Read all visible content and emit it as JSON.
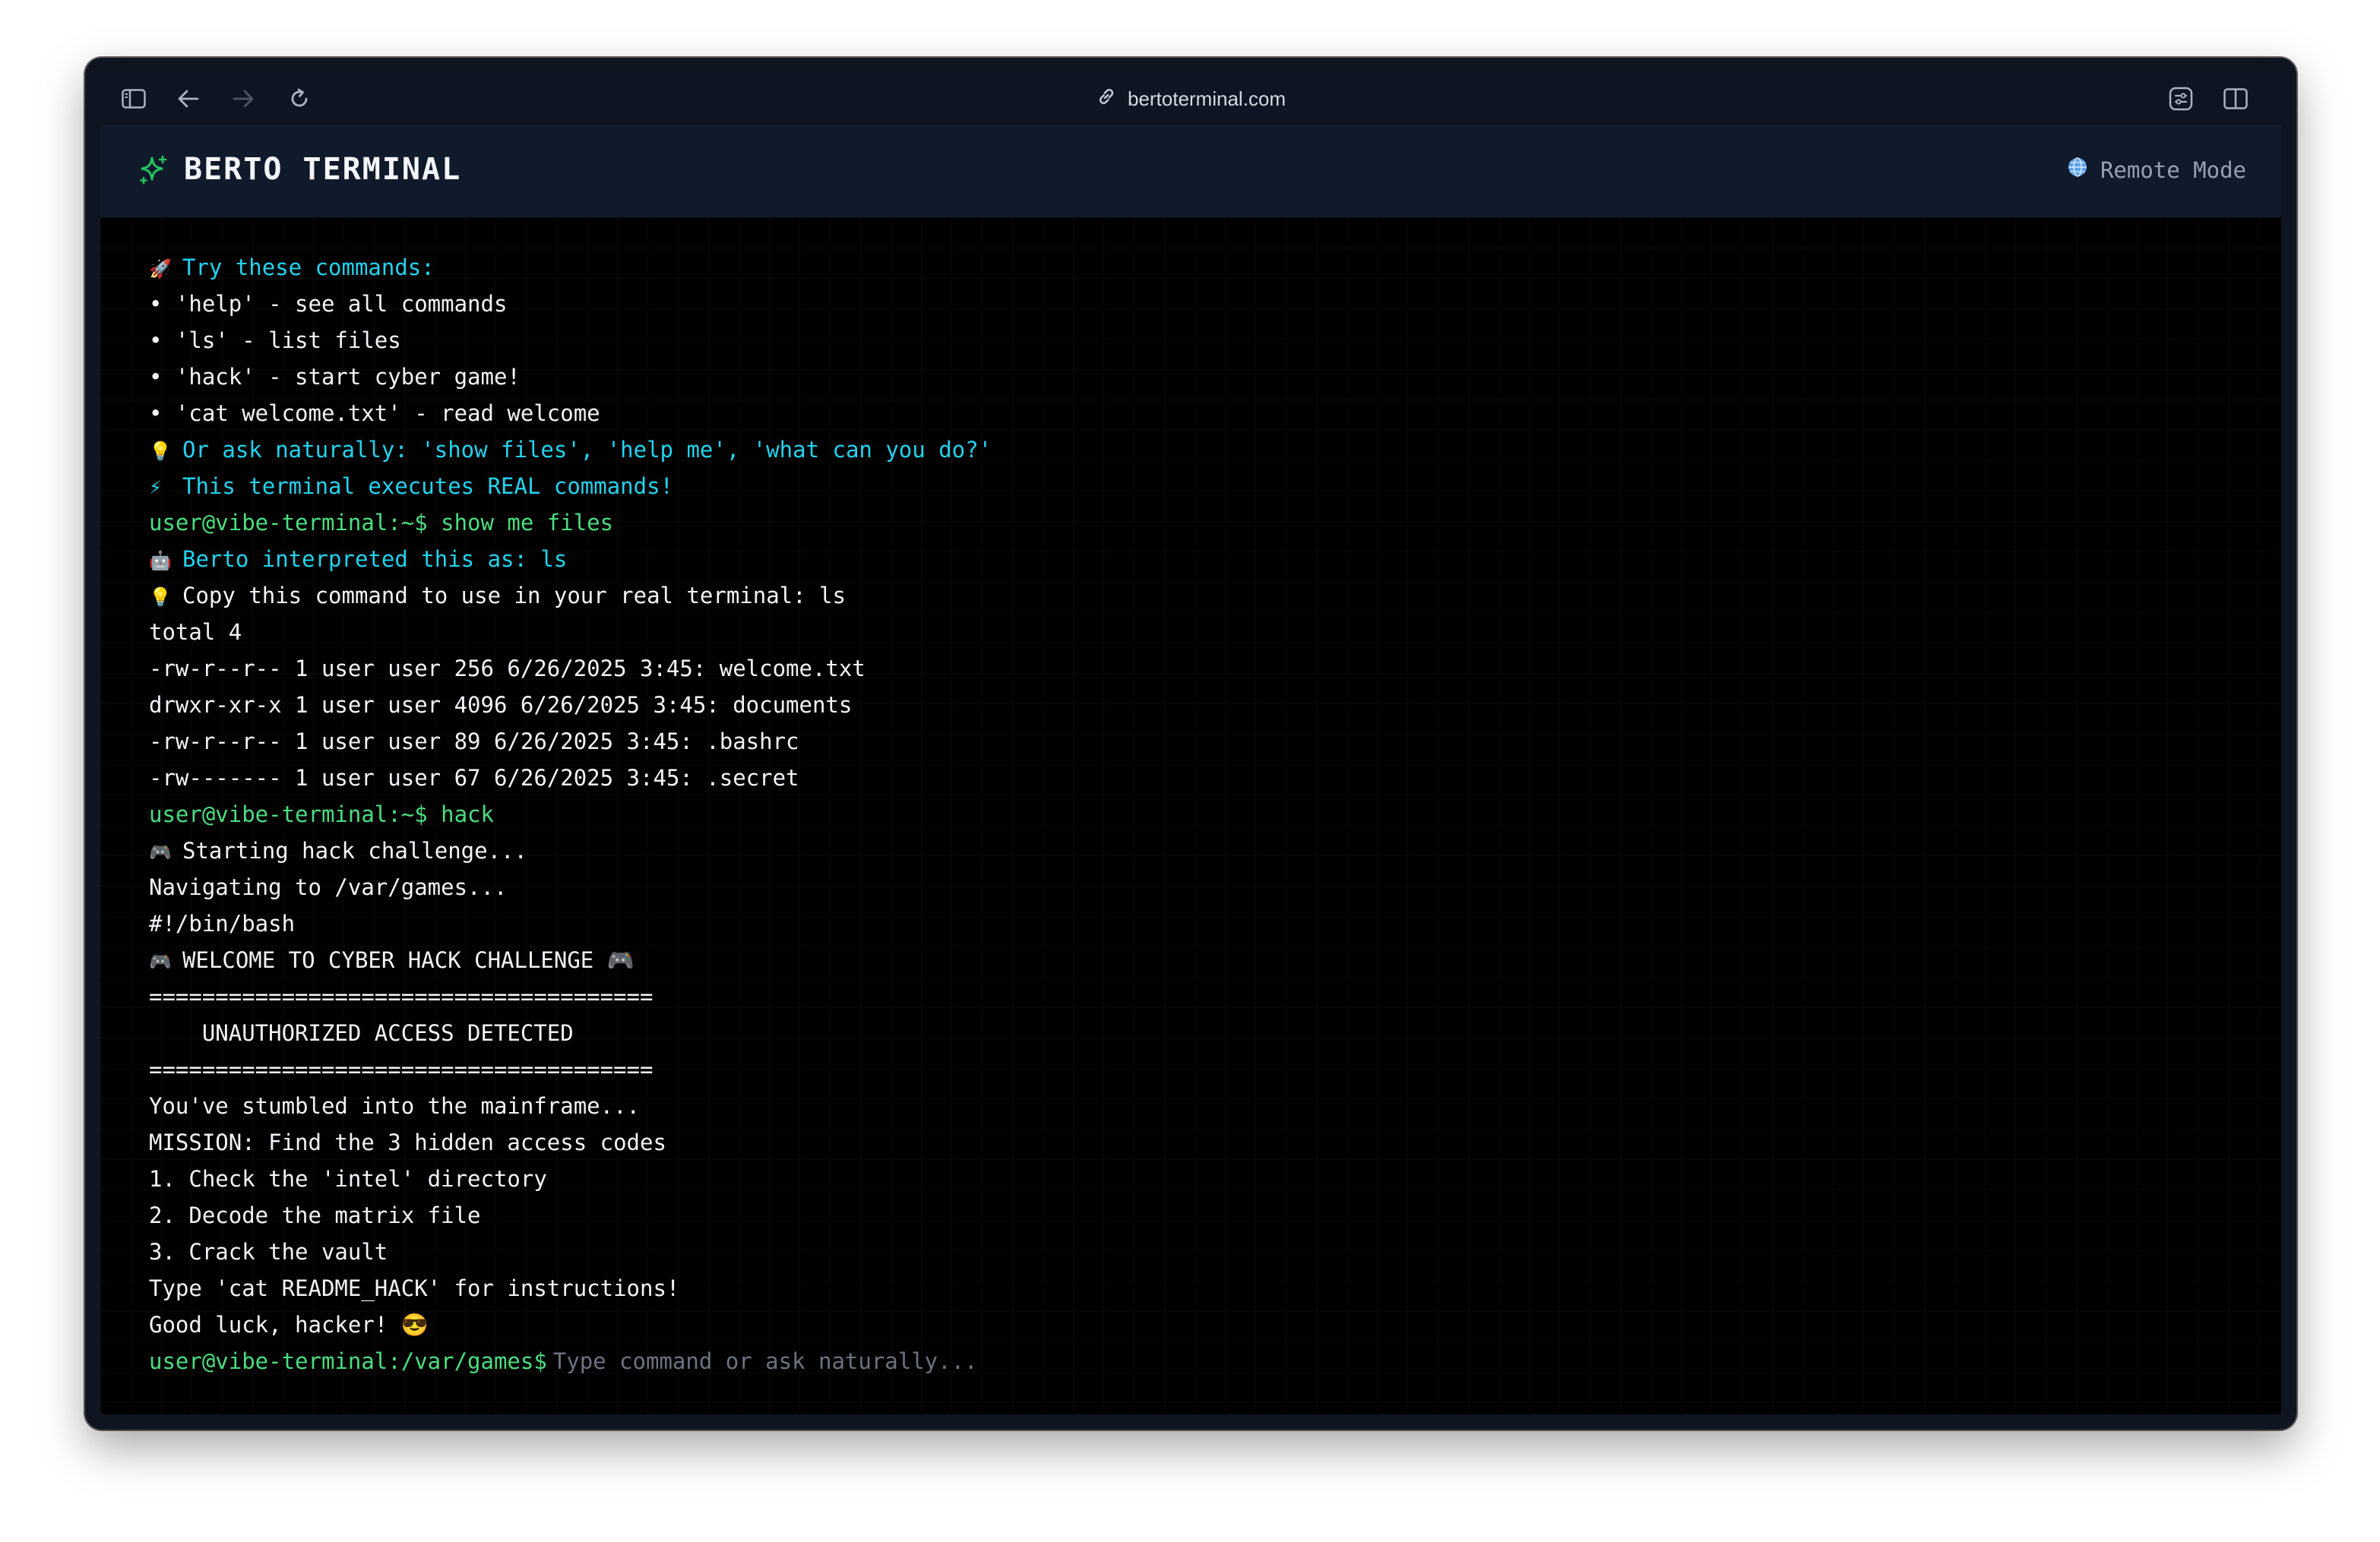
{
  "browser": {
    "url": "bertoterminal.com"
  },
  "app": {
    "title": "BERTO TERMINAL",
    "mode_label": "Remote Mode",
    "accent_color": "#22c55e",
    "cyan_color": "#22d3ee",
    "green_color": "#4ade80"
  },
  "terminal": {
    "lines": [
      {
        "icon": "🚀",
        "text": "Try these commands:",
        "color": "cyan"
      },
      {
        "icon": "",
        "text": "• 'help' - see all commands",
        "color": "white"
      },
      {
        "icon": "",
        "text": "• 'ls' - list files",
        "color": "white"
      },
      {
        "icon": "",
        "text": "• 'hack' - start cyber game!",
        "color": "white"
      },
      {
        "icon": "",
        "text": "• 'cat welcome.txt' - read welcome",
        "color": "white"
      },
      {
        "icon": "💡",
        "text": "Or ask naturally: 'show files', 'help me', 'what can you do?'",
        "color": "cyan"
      },
      {
        "icon": "⚡",
        "text": "This terminal executes REAL commands!",
        "color": "cyan"
      },
      {
        "icon": "",
        "text": "user@vibe-terminal:~$ show me files",
        "color": "green"
      },
      {
        "icon": "🤖",
        "text": "Berto interpreted this as: ls",
        "color": "cyan"
      },
      {
        "icon": "💡",
        "text": "Copy this command to use in your real terminal: ls",
        "color": "white"
      },
      {
        "icon": "",
        "text": "total 4",
        "color": "white"
      },
      {
        "icon": "",
        "text": "-rw-r--r-- 1 user user 256 6/26/2025 3:45: welcome.txt",
        "color": "white"
      },
      {
        "icon": "",
        "text": "drwxr-xr-x 1 user user 4096 6/26/2025 3:45: documents",
        "color": "white"
      },
      {
        "icon": "",
        "text": "-rw-r--r-- 1 user user 89 6/26/2025 3:45: .bashrc",
        "color": "white"
      },
      {
        "icon": "",
        "text": "-rw------- 1 user user 67 6/26/2025 3:45: .secret",
        "color": "white"
      },
      {
        "icon": "",
        "text": "user@vibe-terminal:~$ hack",
        "color": "green"
      },
      {
        "icon": "🎮",
        "text": "Starting hack challenge...",
        "color": "white"
      },
      {
        "icon": "",
        "text": "Navigating to /var/games...",
        "color": "white"
      },
      {
        "icon": "",
        "text": "#!/bin/bash",
        "color": "white"
      },
      {
        "icon": "🎮",
        "text": "WELCOME TO CYBER HACK CHALLENGE 🎮",
        "color": "white"
      },
      {
        "icon": "",
        "text": "======================================",
        "color": "white"
      },
      {
        "icon": "",
        "text": "    UNAUTHORIZED ACCESS DETECTED",
        "color": "white"
      },
      {
        "icon": "",
        "text": "======================================",
        "color": "white"
      },
      {
        "icon": "",
        "text": "You've stumbled into the mainframe...",
        "color": "white"
      },
      {
        "icon": "",
        "text": "MISSION: Find the 3 hidden access codes",
        "color": "white"
      },
      {
        "icon": "",
        "text": "1. Check the 'intel' directory",
        "color": "white"
      },
      {
        "icon": "",
        "text": "2. Decode the matrix file",
        "color": "white"
      },
      {
        "icon": "",
        "text": "3. Crack the vault",
        "color": "white"
      },
      {
        "icon": "",
        "text": "Type 'cat README_HACK' for instructions!",
        "color": "white"
      },
      {
        "icon": "",
        "text": "Good luck, hacker! 😎",
        "color": "white"
      }
    ],
    "prompt": "user@vibe-terminal:/var/games$",
    "input_value": "",
    "input_placeholder": "Type command or ask naturally..."
  }
}
